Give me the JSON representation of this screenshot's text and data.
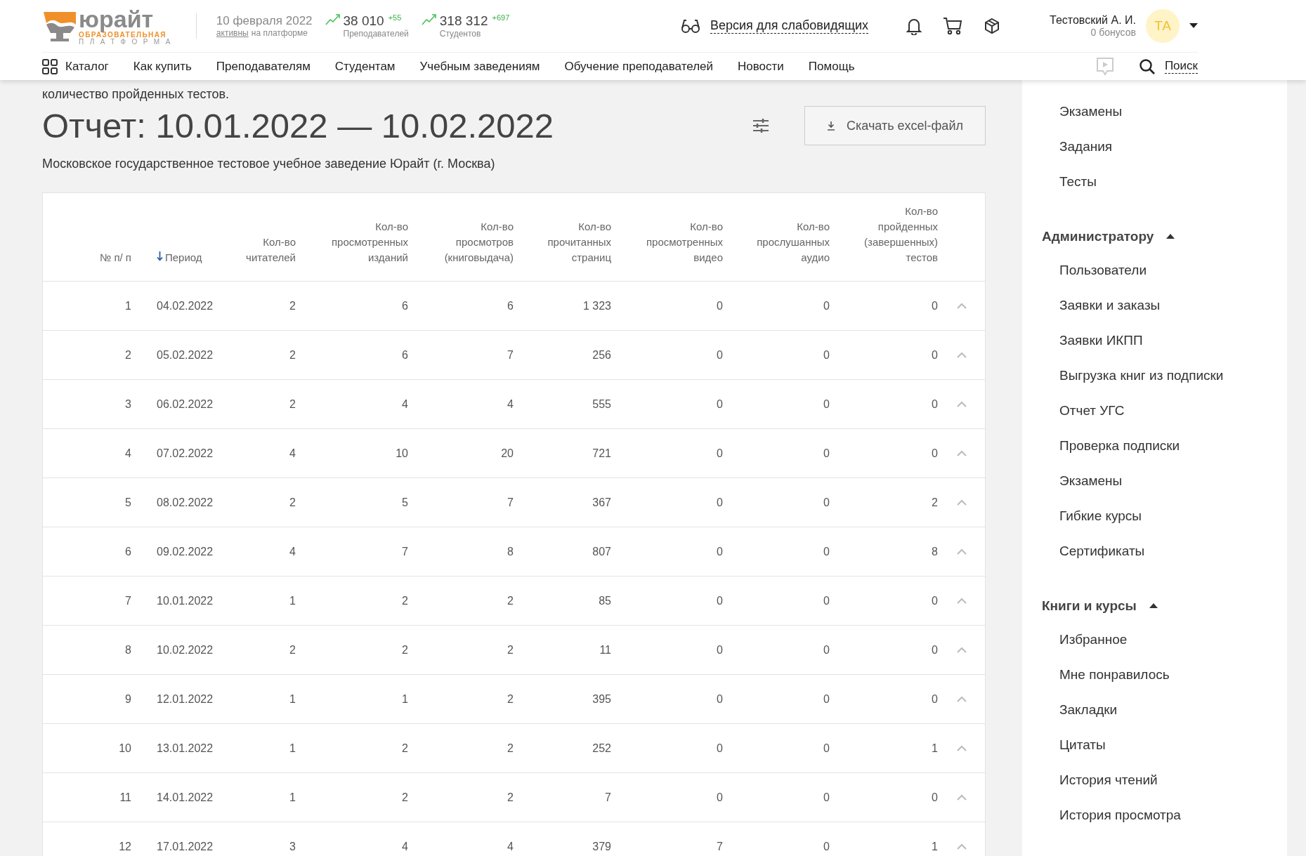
{
  "header": {
    "logo": {
      "name": "юрайт",
      "line1": "ОБРАЗОВАТЕЛЬНАЯ",
      "line2": "ПЛАТФОРМА"
    },
    "date": "10 февраля 2022",
    "active_link": "активны",
    "active_text": "на платформе",
    "stats": [
      {
        "value": "38 010",
        "delta": "+55",
        "label": "Преподавателей"
      },
      {
        "value": "318 312",
        "delta": "+697",
        "label": "Студентов"
      }
    ],
    "accessibility_link": "Версия для слабовидящих",
    "user": {
      "name": "Тестовский А. И.",
      "bonus": "0 бонусов",
      "initials": "ТА"
    },
    "nav": [
      "Каталог",
      "Как купить",
      "Преподавателям",
      "Студентам",
      "Учебным заведениям",
      "Обучение преподавателей",
      "Новости",
      "Помощь"
    ],
    "search": "Поиск"
  },
  "intro": "количество пройденных тестов.",
  "report": {
    "title": "Отчет: 10.01.2022 — 10.02.2022",
    "download": "Скачать excel-файл",
    "organization": "Московское государственное тестовое учебное заведение Юрайт (г. Москва)"
  },
  "table": {
    "columns": [
      {
        "label": "№ п/ п",
        "sorted": false
      },
      {
        "label": "Период",
        "sorted": true
      },
      {
        "label": "Кол-во читателей",
        "sorted": false
      },
      {
        "label": "Кол-во просмотренных изданий",
        "sorted": false
      },
      {
        "label": "Кол-во просмотров (книговыдача)",
        "sorted": false
      },
      {
        "label": "Кол-во прочитанных страниц",
        "sorted": false
      },
      {
        "label": "Кол-во просмотренных видео",
        "sorted": false
      },
      {
        "label": "Кол-во прослушанных аудио",
        "sorted": false
      },
      {
        "label": "Кол-во пройденных (завершенных) тестов",
        "sorted": false
      }
    ],
    "rows": [
      [
        "1",
        "04.02.2022",
        "2",
        "6",
        "6",
        "1 323",
        "0",
        "0",
        "0"
      ],
      [
        "2",
        "05.02.2022",
        "2",
        "6",
        "7",
        "256",
        "0",
        "0",
        "0"
      ],
      [
        "3",
        "06.02.2022",
        "2",
        "4",
        "4",
        "555",
        "0",
        "0",
        "0"
      ],
      [
        "4",
        "07.02.2022",
        "4",
        "10",
        "20",
        "721",
        "0",
        "0",
        "0"
      ],
      [
        "5",
        "08.02.2022",
        "2",
        "5",
        "7",
        "367",
        "0",
        "0",
        "2"
      ],
      [
        "6",
        "09.02.2022",
        "4",
        "7",
        "8",
        "807",
        "0",
        "0",
        "8"
      ],
      [
        "7",
        "10.01.2022",
        "1",
        "2",
        "2",
        "85",
        "0",
        "0",
        "0"
      ],
      [
        "8",
        "10.02.2022",
        "2",
        "2",
        "2",
        "11",
        "0",
        "0",
        "0"
      ],
      [
        "9",
        "12.01.2022",
        "1",
        "1",
        "2",
        "395",
        "0",
        "0",
        "0"
      ],
      [
        "10",
        "13.01.2022",
        "1",
        "2",
        "2",
        "252",
        "0",
        "0",
        "1"
      ],
      [
        "11",
        "14.01.2022",
        "1",
        "2",
        "2",
        "7",
        "0",
        "0",
        "0"
      ],
      [
        "12",
        "17.01.2022",
        "3",
        "4",
        "4",
        "379",
        "7",
        "0",
        "1"
      ]
    ]
  },
  "sidebar": [
    {
      "items": [
        "Экзамены",
        "Задания",
        "Тесты"
      ]
    },
    {
      "title": "Администратору",
      "expanded": true,
      "items": [
        "Пользователи",
        "Заявки и заказы",
        "Заявки ИКПП",
        "Выгрузка книг из подписки",
        "Отчет УГС",
        "Проверка подписки",
        "Экзамены",
        "Гибкие курсы",
        "Сертификаты"
      ]
    },
    {
      "title": "Книги и курсы",
      "expanded": true,
      "items": [
        "Избранное",
        "Мне понравилось",
        "Закладки",
        "Цитаты",
        "История чтений",
        "История просмотра"
      ]
    }
  ]
}
